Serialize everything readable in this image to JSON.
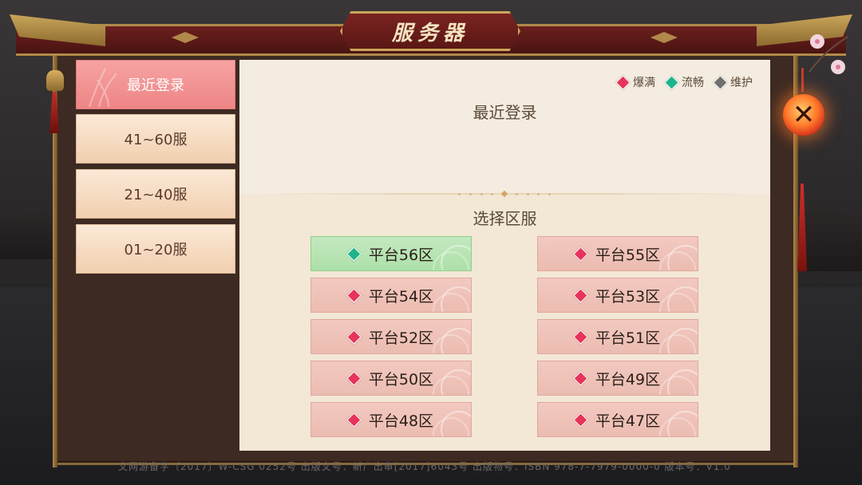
{
  "header": {
    "title": "服务器"
  },
  "legend": [
    {
      "label": "爆满",
      "color": "#e8335a"
    },
    {
      "label": "流畅",
      "color": "#1fb38a"
    },
    {
      "label": "维护",
      "color": "#6f6f6f"
    }
  ],
  "sidebar": {
    "tabs": [
      {
        "label": "最近登录",
        "active": true
      },
      {
        "label": "41~60服",
        "active": false
      },
      {
        "label": "21~40服",
        "active": false
      },
      {
        "label": "01~20服",
        "active": false
      }
    ]
  },
  "main": {
    "recent_title": "最近登录",
    "select_title": "选择区服",
    "servers": [
      {
        "label": "平台56区",
        "status": "流畅",
        "color": "#1fb38a"
      },
      {
        "label": "平台55区",
        "status": "爆满",
        "color": "#e8335a"
      },
      {
        "label": "平台54区",
        "status": "爆满",
        "color": "#e8335a"
      },
      {
        "label": "平台53区",
        "status": "爆满",
        "color": "#e8335a"
      },
      {
        "label": "平台52区",
        "status": "爆满",
        "color": "#e8335a"
      },
      {
        "label": "平台51区",
        "status": "爆满",
        "color": "#e8335a"
      },
      {
        "label": "平台50区",
        "status": "爆满",
        "color": "#e8335a"
      },
      {
        "label": "平台49区",
        "status": "爆满",
        "color": "#e8335a"
      },
      {
        "label": "平台48区",
        "status": "爆满",
        "color": "#e8335a"
      },
      {
        "label": "平台47区",
        "status": "爆满",
        "color": "#e8335a"
      }
    ]
  },
  "icons": {
    "close": "close-icon",
    "status": "diamond-icon"
  },
  "footer": {
    "text": "文网游备字〔2017〕W-CSG 0252号    出版文号：新广出审[2017]6043号    出版物号：ISBN 978-7-7979-0000-0    版本号：V1.0"
  }
}
